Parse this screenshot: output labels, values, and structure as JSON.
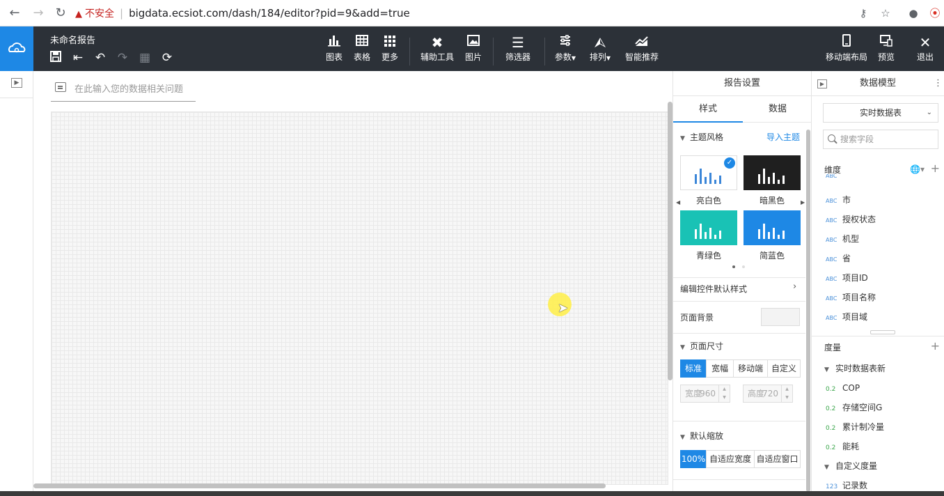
{
  "browser": {
    "security_label": "不安全",
    "url": "bigdata.ecsiot.com/dash/184/editor?pid=9&add=true"
  },
  "header": {
    "doc_title": "未命名报告",
    "tools": [
      {
        "icon": "bar-chart-icon",
        "label": "图表"
      },
      {
        "icon": "table-icon",
        "label": "表格"
      },
      {
        "icon": "grid-more-icon",
        "label": "更多"
      },
      {
        "icon": "tools-icon",
        "label": "辅助工具"
      },
      {
        "icon": "image-icon",
        "label": "图片"
      },
      {
        "icon": "filter-icon",
        "label": "筛选器"
      },
      {
        "icon": "sliders-icon",
        "label": "参数"
      },
      {
        "icon": "arrange-icon",
        "label": "排列"
      },
      {
        "icon": "smart-recommend-icon",
        "label": "智能推荐"
      }
    ],
    "right_tools": [
      {
        "icon": "mobile-icon",
        "label": "移动端布局"
      },
      {
        "icon": "preview-icon",
        "label": "预览"
      },
      {
        "icon": "close-icon",
        "label": "退出"
      }
    ]
  },
  "canvas": {
    "query_placeholder": "在此输入您的数据相关问题"
  },
  "settings": {
    "title": "报告设置",
    "tab_style": "样式",
    "tab_data": "数据",
    "theme_section": "主题风格",
    "import_theme": "导入主题",
    "themes": [
      {
        "label": "亮白色",
        "bg": "#ffffff",
        "bar": "#3b86d8",
        "selected": true
      },
      {
        "label": "暗黑色",
        "bg": "#1f1f1f",
        "bar": "#ffffff",
        "selected": false
      },
      {
        "label": "青绿色",
        "bg": "#19c2b5",
        "bar": "#ffffff",
        "selected": false
      },
      {
        "label": "简蓝色",
        "bg": "#1e88e5",
        "bar": "#ffffff",
        "selected": false
      }
    ],
    "edit_default_style": "编辑控件默认样式",
    "page_bg": "页面背景",
    "page_size_section": "页面尺寸",
    "size_options": [
      "标准",
      "宽幅",
      "移动端",
      "自定义"
    ],
    "width_label": "宽度",
    "width_value": "960",
    "height_label": "高度",
    "height_value": "720",
    "zoom_section": "默认缩放",
    "zoom_options": [
      "100%",
      "自适应宽度",
      "自适应窗口"
    ]
  },
  "model": {
    "title": "数据模型",
    "datasource": "实时数据表",
    "search_placeholder": "搜索字段",
    "dimension_label": "维度",
    "dimensions": [
      "市",
      "授权状态",
      "机型",
      "省",
      "项目ID",
      "项目名称",
      "项目域"
    ],
    "dimension_type": "ABC",
    "measure_label": "度量",
    "measure_group": "实时数据表新",
    "measures": [
      "COP",
      "存储空间G",
      "累计制冷量",
      "能耗"
    ],
    "measure_type": "0.2",
    "custom_group": "自定义度量",
    "custom_measures": [
      "记录数"
    ],
    "custom_type": "123"
  },
  "colors": {
    "accent": "#1e88e5",
    "header_bg": "#2c3138",
    "warning": "#c5221f"
  }
}
